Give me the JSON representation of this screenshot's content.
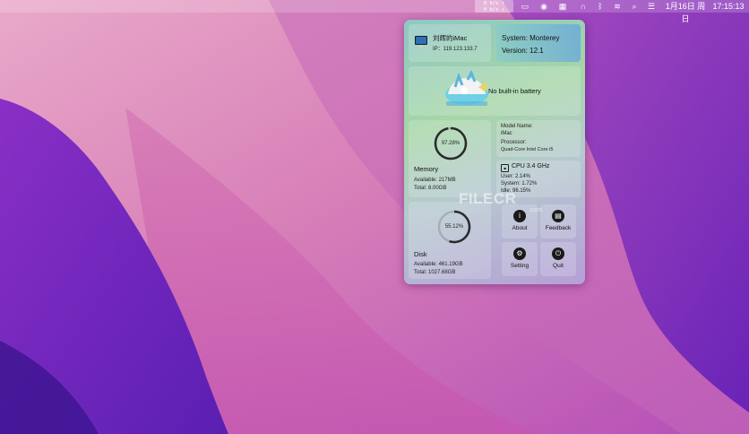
{
  "menubar": {
    "net_up": "0 b/s ↑",
    "net_down": "0 b/s ↓",
    "date": "1月16日 周日",
    "time": "17:15:13"
  },
  "header": {
    "computer_name": "刘辉的iMac",
    "ip": "IP：119.123.133.7",
    "system": "System: Monterey",
    "version": "Version: 12.1"
  },
  "battery": {
    "status": "No built-in battery"
  },
  "memory": {
    "percent": "97.28%",
    "fraction": 0.9728,
    "title": "Memory",
    "available": "Available: 217MB",
    "total": "Total: 8.00GB"
  },
  "model": {
    "name_label": "Model Name:",
    "name_value": "iMac",
    "processor_label": "Processor:",
    "processor_value": "Quad-Core Intel Core i5"
  },
  "cpu": {
    "title": "CPU  3.4 GHz",
    "user": "User:   2.14%",
    "system": "System:   1.72%",
    "idle": "Idle:   96.15%"
  },
  "disk": {
    "percent": "55.12%",
    "fraction": 0.5512,
    "title": "Disk",
    "available": "Available: 461.19GB",
    "total": "Total: 1027.68GB"
  },
  "buttons": {
    "about": "About",
    "feedback": "Feedback",
    "setting": "Setting",
    "quit": "Quit"
  },
  "watermark": {
    "brand": "FILECR",
    "domain": ".com"
  }
}
